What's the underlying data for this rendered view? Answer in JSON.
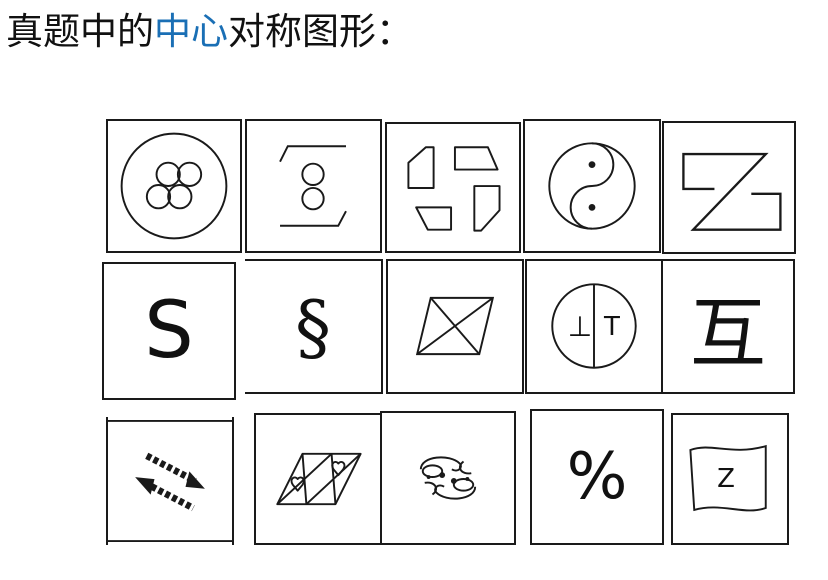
{
  "heading": {
    "prefix": "真题中的",
    "highlight": "中心",
    "suffix": "对称图形："
  },
  "colors": {
    "text": "#111111",
    "highlight": "#1a6fb5",
    "line": "#1a1a1a",
    "background": "#ffffff"
  },
  "figures": {
    "letter_s": "S",
    "section_sign": "§",
    "tack_left": "⊥",
    "tack_right": "T",
    "hu_char": "互",
    "percent": "%",
    "z_letter": "Z"
  }
}
